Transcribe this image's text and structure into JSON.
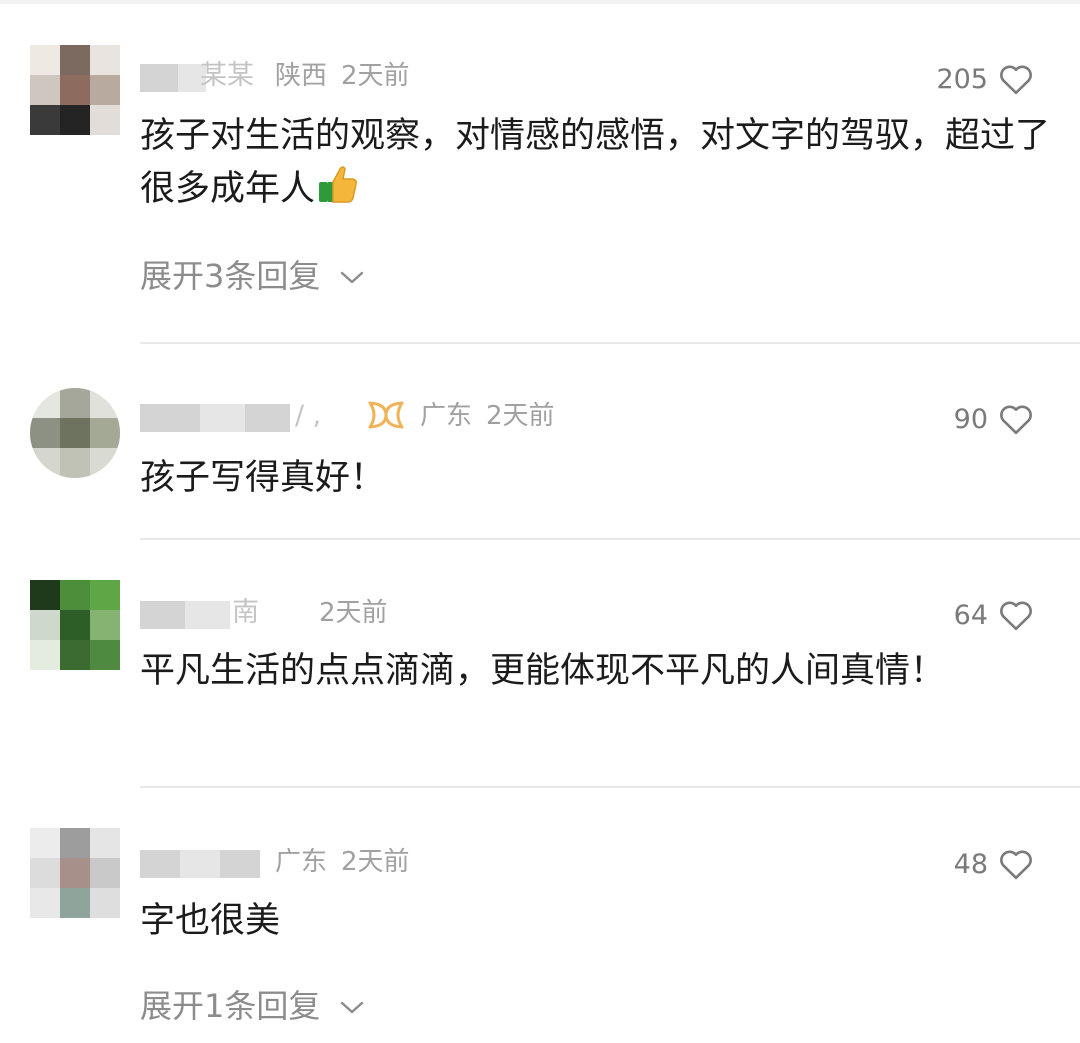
{
  "comments": [
    {
      "username_visible": "某某",
      "location": "陕西",
      "time": "2天前",
      "likes": "205",
      "text": "孩子对生活的观察，对情感的感悟，对文字的驾驭，超过了很多成年人",
      "emoji": "thumbs-up-icon",
      "reply_label": "展开3条回复"
    },
    {
      "username_visible": "/ ,",
      "location": "广东",
      "time": "2天前",
      "likes": "90",
      "text": "孩子写得真好！",
      "badge": "vip-badge-icon"
    },
    {
      "username_visible": "南",
      "location": "",
      "time": "2天前",
      "likes": "64",
      "text": "平凡生活的点点滴滴，更能体现不平凡的人间真情！"
    },
    {
      "username_visible": "",
      "location": "广东",
      "time": "2天前",
      "likes": "48",
      "text": "字也很美",
      "reply_label": "展开1条回复"
    }
  ],
  "colors": {
    "text": "#1b1b1b",
    "meta": "#a1a1a1",
    "like_count": "#7a7a7a",
    "reply_link": "#8c8c8c",
    "badge": "#f0b35a",
    "divider": "#e9e9e9"
  }
}
